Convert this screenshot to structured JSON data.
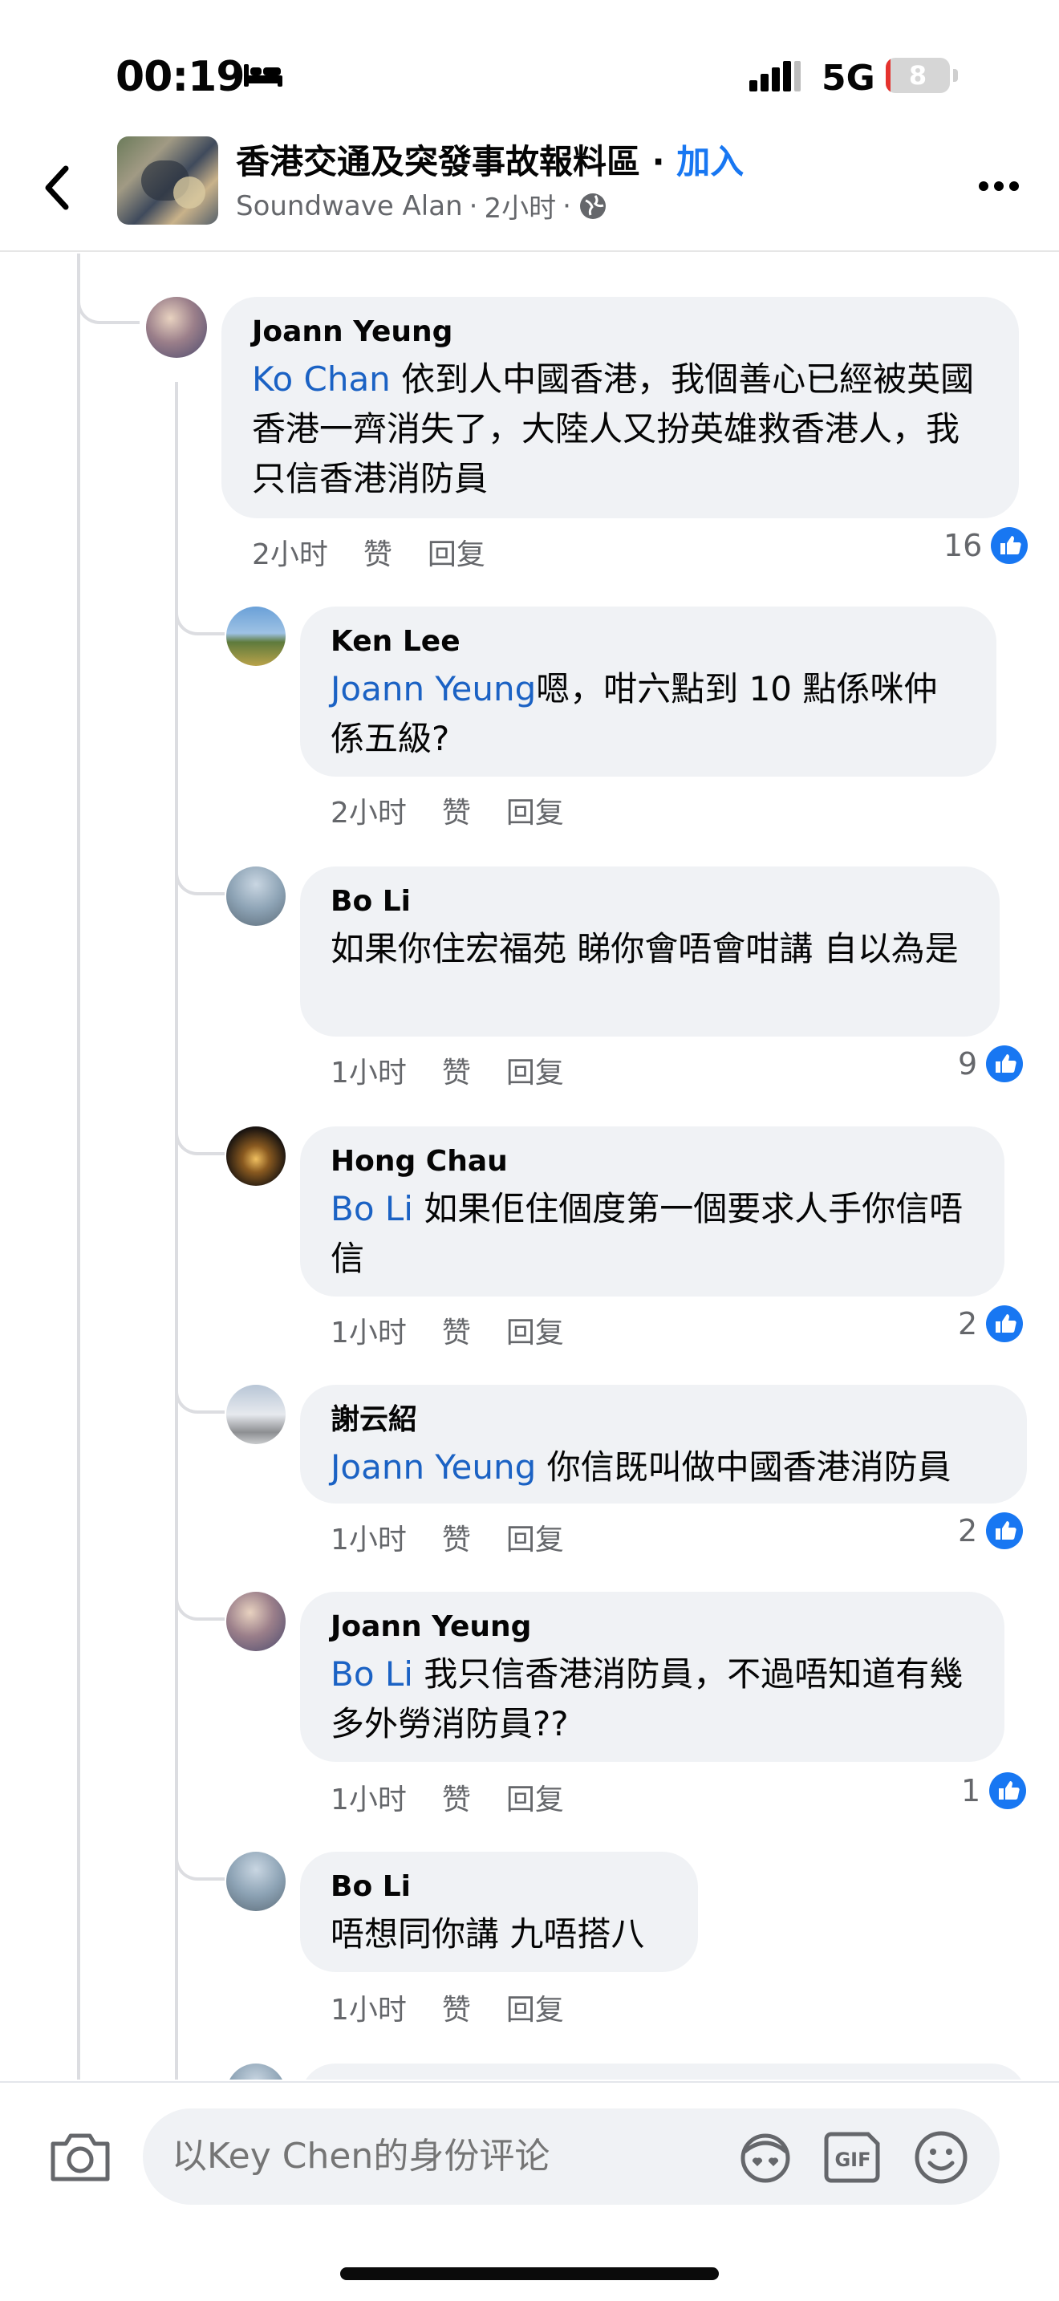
{
  "status_bar": {
    "time": "00:19",
    "network": "5G",
    "battery": "8",
    "battery_level_fraction": 0.08
  },
  "header": {
    "group_name": "香港交通及突發事故報料區",
    "separator": " · ",
    "join_label": "加入",
    "author": "Soundwave Alan",
    "time": "2小时"
  },
  "comments": [
    {
      "author": "Joann Yeung",
      "mention": "Ko Chan",
      "text": " 依到人中國香港，我個善心已經被英國香港一齊消失了，大陸人又扮英雄救香港人，我只信香港消防員",
      "time": "2小时",
      "like": "赞",
      "reply": "回复",
      "likes": "16"
    },
    {
      "author": "Ken  Lee",
      "mention": "Joann Yeung",
      "text": "嗯，咁六點到 10 點係咪仲係五級?",
      "time": "2小时",
      "like": "赞",
      "reply": "回复",
      "likes": ""
    },
    {
      "author": "Bo Li",
      "mention": "",
      "text": "如果你住宏福苑 睇你會唔會咁講 自以為是",
      "time": "1小时",
      "like": "赞",
      "reply": "回复",
      "likes": "9"
    },
    {
      "author": "Hong Chau",
      "mention": "Bo Li",
      "text": " 如果佢住個度第一個要求人手你信唔信",
      "time": "1小时",
      "like": "赞",
      "reply": "回复",
      "likes": "2"
    },
    {
      "author": "謝云紹",
      "mention": "Joann Yeung",
      "text": " 你信既叫做中國香港消防員",
      "time": "1小时",
      "like": "赞",
      "reply": "回复",
      "likes": "2"
    },
    {
      "author": "Joann Yeung",
      "mention": "Bo Li",
      "text": " 我只信香港消防員，不過唔知道有幾多外勞消防員??",
      "time": "1小时",
      "like": "赞",
      "reply": "回复",
      "likes": "1"
    },
    {
      "author": "Bo Li",
      "mention": "",
      "text": "唔想同你講 九唔搭八",
      "time": "1小时",
      "like": "赞",
      "reply": "回复",
      "likes": ""
    }
  ],
  "composer": {
    "placeholder": "以Key Chen的身份评论"
  },
  "icons": [
    "back-icon",
    "group-avatar",
    "globe-icon",
    "more-icon",
    "like-icon",
    "camera-icon",
    "avatar-sticker-icon",
    "gif-icon",
    "emoji-icon"
  ],
  "colors": {
    "link": "#1877f2",
    "mention": "#1b62c4",
    "bubble": "#f0f2f5",
    "meta": "#65676b"
  }
}
